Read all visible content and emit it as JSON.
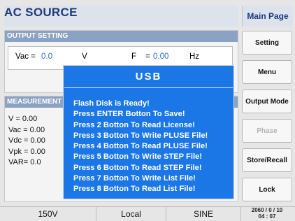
{
  "header": {
    "title": "AC SOURCE",
    "main_page": "Main Page"
  },
  "output_setting": {
    "title": "OUTPUT SETTING",
    "vac_label": "Vac =",
    "vac_value": "0.0",
    "vac_unit": "V",
    "f_label": "F",
    "f_equals": "=",
    "f_value": "0.00",
    "f_unit": "Hz"
  },
  "measurement": {
    "title": "MEASUREMENT",
    "items": [
      "V    = 0.00",
      "Vac = 0.00",
      "Vdc = 0.00",
      "Vpk = 0.00",
      "VAR= 0.0"
    ]
  },
  "side_buttons": [
    "Setting",
    "Menu",
    "Output Mode",
    "Phase",
    "Store/Recall",
    "Lock"
  ],
  "status": {
    "range": "150V",
    "mode": "Local",
    "waveform": "SINE",
    "datetime": [
      "2060 / 0 / 10",
      "04 : 07"
    ]
  },
  "dialog": {
    "title": "USB",
    "lines": [
      "Flash Disk is Ready!",
      "Press ENTER Botton To Save!",
      "Press 2 Botton To Read License!",
      "Press 3 Botton To Write PLUSE File!",
      "Press 4 Botton To Read PLUSE File!",
      "Press 5 Botton To Write STEP File!",
      "Press 6 Botton To Read STEP File!",
      "Press 7 Botton To Write List File!",
      "Press 8 Botton To Read List File!"
    ]
  }
}
